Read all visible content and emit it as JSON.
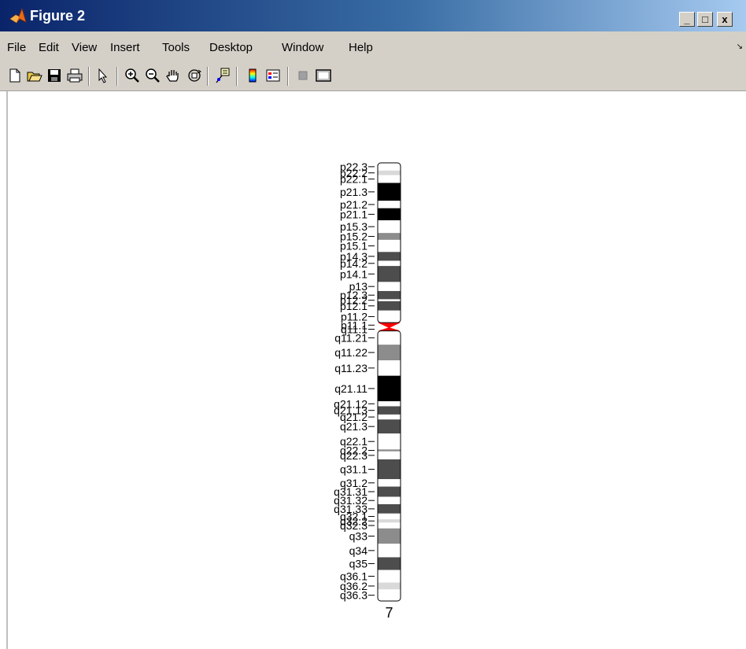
{
  "window": {
    "title": "Figure 2",
    "controls": {
      "minimize": "_",
      "maximize": "□",
      "close": "x"
    }
  },
  "menu": [
    "File",
    "Edit",
    "View",
    "Insert",
    "Tools",
    "Desktop",
    "Window",
    "Help"
  ],
  "toolbar": [
    "new-figure-icon",
    "open-file-icon",
    "save-icon",
    "print-icon",
    "pointer-icon",
    "zoom-in-icon",
    "zoom-out-icon",
    "pan-hand-icon",
    "rotate-3d-icon",
    "data-cursor-icon",
    "colorbar-icon",
    "legend-icon",
    "plot-tools-hide-icon",
    "plot-tools-show-icon"
  ],
  "colors": {
    "title_gradient_start": "#0a246a",
    "title_gradient_end": "#a6caf0",
    "chrome": "#d4d0c8",
    "centromere": "#ff0000"
  },
  "chart_data": {
    "type": "ideogram",
    "chromosome": "7",
    "bands": [
      {
        "name": "p22.3",
        "start": 0,
        "end": 2.8,
        "stain": "gneg"
      },
      {
        "name": "p22.2",
        "start": 2.8,
        "end": 4.5,
        "stain": "gpos25"
      },
      {
        "name": "p22.1",
        "start": 4.5,
        "end": 7.3,
        "stain": "gneg"
      },
      {
        "name": "p21.3",
        "start": 7.3,
        "end": 13.8,
        "stain": "gpos100"
      },
      {
        "name": "p21.2",
        "start": 13.8,
        "end": 16.5,
        "stain": "gneg"
      },
      {
        "name": "p21.1",
        "start": 16.5,
        "end": 20.9,
        "stain": "gpos100"
      },
      {
        "name": "p15.3",
        "start": 20.9,
        "end": 25.5,
        "stain": "gneg"
      },
      {
        "name": "p15.2",
        "start": 25.5,
        "end": 28.0,
        "stain": "gpos50"
      },
      {
        "name": "p15.1",
        "start": 28.0,
        "end": 32.4,
        "stain": "gneg"
      },
      {
        "name": "p14.3",
        "start": 32.4,
        "end": 35.6,
        "stain": "gpos75"
      },
      {
        "name": "p14.2",
        "start": 35.6,
        "end": 37.5,
        "stain": "gneg"
      },
      {
        "name": "p14.1",
        "start": 37.5,
        "end": 43.3,
        "stain": "gpos75"
      },
      {
        "name": "p13",
        "start": 43.3,
        "end": 46.6,
        "stain": "gneg"
      },
      {
        "name": "p12.3",
        "start": 46.6,
        "end": 49.6,
        "stain": "gpos75"
      },
      {
        "name": "p12.2",
        "start": 49.6,
        "end": 50.3,
        "stain": "gneg"
      },
      {
        "name": "p12.1",
        "start": 50.3,
        "end": 53.7,
        "stain": "gpos75"
      },
      {
        "name": "p11.2",
        "start": 53.7,
        "end": 58.1,
        "stain": "gneg"
      },
      {
        "name": "p11.1",
        "start": 58.1,
        "end": 59.9,
        "stain": "acen"
      },
      {
        "name": "q11.1",
        "start": 59.9,
        "end": 61.1,
        "stain": "acen"
      },
      {
        "name": "q11.21",
        "start": 61.1,
        "end": 66.1,
        "stain": "gneg"
      },
      {
        "name": "q11.22",
        "start": 66.1,
        "end": 71.8,
        "stain": "gpos50"
      },
      {
        "name": "q11.23",
        "start": 71.8,
        "end": 77.4,
        "stain": "gneg"
      },
      {
        "name": "q21.11",
        "start": 77.4,
        "end": 86.7,
        "stain": "gpos100"
      },
      {
        "name": "q21.12",
        "start": 86.7,
        "end": 88.5,
        "stain": "gneg"
      },
      {
        "name": "q21.13",
        "start": 88.5,
        "end": 91.5,
        "stain": "gpos75"
      },
      {
        "name": "q21.2",
        "start": 91.5,
        "end": 93.3,
        "stain": "gneg"
      },
      {
        "name": "q21.3",
        "start": 93.3,
        "end": 98.4,
        "stain": "gpos75"
      },
      {
        "name": "q22.1",
        "start": 98.4,
        "end": 104.2,
        "stain": "gneg"
      },
      {
        "name": "q22.2",
        "start": 104.2,
        "end": 104.9,
        "stain": "gpos50"
      },
      {
        "name": "q22.3",
        "start": 104.9,
        "end": 107.8,
        "stain": "gneg"
      },
      {
        "name": "q31.1",
        "start": 107.8,
        "end": 115.0,
        "stain": "gpos75"
      },
      {
        "name": "q31.2",
        "start": 115.0,
        "end": 117.7,
        "stain": "gneg"
      },
      {
        "name": "q31.31",
        "start": 117.7,
        "end": 121.4,
        "stain": "gpos75"
      },
      {
        "name": "q31.32",
        "start": 121.4,
        "end": 124.1,
        "stain": "gneg"
      },
      {
        "name": "q31.33",
        "start": 124.1,
        "end": 127.5,
        "stain": "gpos75"
      },
      {
        "name": "q32.1",
        "start": 127.5,
        "end": 129.6,
        "stain": "gneg"
      },
      {
        "name": "q32.2",
        "start": 129.6,
        "end": 130.8,
        "stain": "gpos25"
      },
      {
        "name": "q32.3",
        "start": 130.8,
        "end": 132.9,
        "stain": "gneg"
      },
      {
        "name": "q33",
        "start": 132.9,
        "end": 138.5,
        "stain": "gpos50"
      },
      {
        "name": "q34",
        "start": 138.5,
        "end": 143.4,
        "stain": "gneg"
      },
      {
        "name": "q35",
        "start": 143.4,
        "end": 148.0,
        "stain": "gpos75"
      },
      {
        "name": "q36.1",
        "start": 148.0,
        "end": 152.6,
        "stain": "gneg"
      },
      {
        "name": "q36.2",
        "start": 152.6,
        "end": 155.1,
        "stain": "gpos25"
      },
      {
        "name": "q36.3",
        "start": 155.1,
        "end": 159.3,
        "stain": "gneg"
      }
    ],
    "stain_colors": {
      "gneg": "#ffffff",
      "gpos25": "#d9d9d9",
      "gpos50": "#8c8c8c",
      "gpos75": "#4d4d4d",
      "gpos100": "#000000",
      "acen": "#ff0000"
    }
  }
}
